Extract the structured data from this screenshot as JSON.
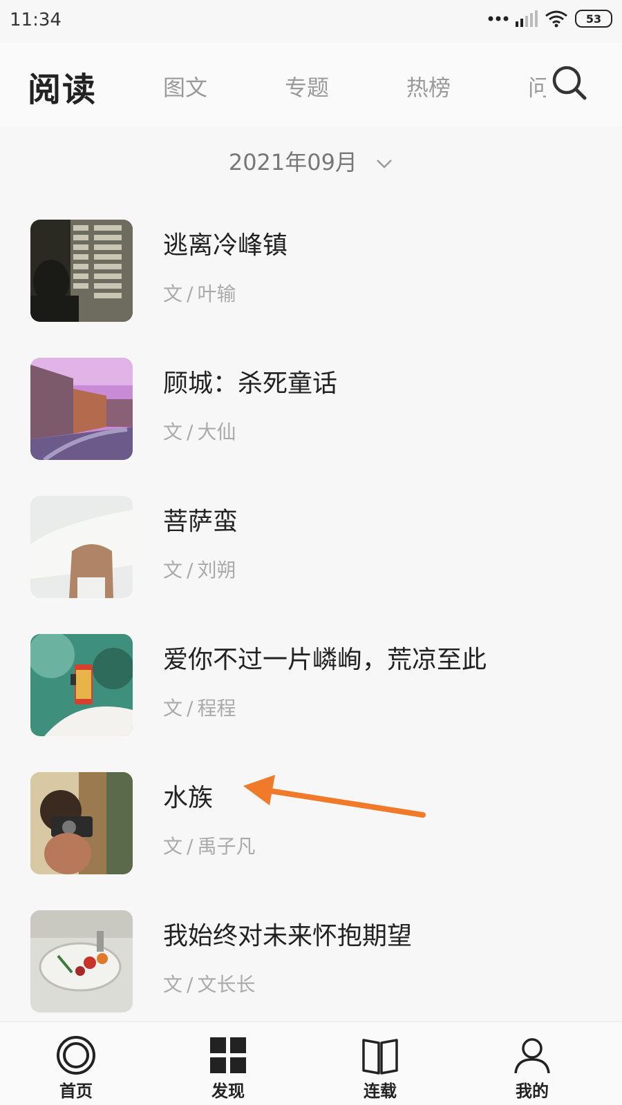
{
  "status": {
    "time": "11:34",
    "battery": "53"
  },
  "header": {
    "title": "阅读",
    "tabs": [
      "图文",
      "专题",
      "热榜",
      "问"
    ]
  },
  "month_picker": {
    "label": "2021年09月"
  },
  "articles": [
    {
      "title": "逃离冷峰镇",
      "prefix": "文",
      "sep": "/",
      "author": "叶输"
    },
    {
      "title": "顾城：杀死童话",
      "prefix": "文",
      "sep": "/",
      "author": "大仙"
    },
    {
      "title": "菩萨蛮",
      "prefix": "文",
      "sep": "/",
      "author": "刘朔"
    },
    {
      "title": "爱你不过一片嶙峋，荒凉至此",
      "prefix": "文",
      "sep": "/",
      "author": "程程"
    },
    {
      "title": "水族",
      "prefix": "文",
      "sep": "/",
      "author": "禹子凡"
    },
    {
      "title": "我始终对未来怀抱期望",
      "prefix": "文",
      "sep": "/",
      "author": "文长长"
    }
  ],
  "bottom_nav": [
    {
      "label": "首页",
      "icon": "home-circle-icon"
    },
    {
      "label": "发现",
      "icon": "grid-icon"
    },
    {
      "label": "连载",
      "icon": "book-icon"
    },
    {
      "label": "我的",
      "icon": "user-icon"
    }
  ],
  "colors": {
    "accent_arrow": "#f07a2a",
    "background": "#f7f7f7"
  }
}
